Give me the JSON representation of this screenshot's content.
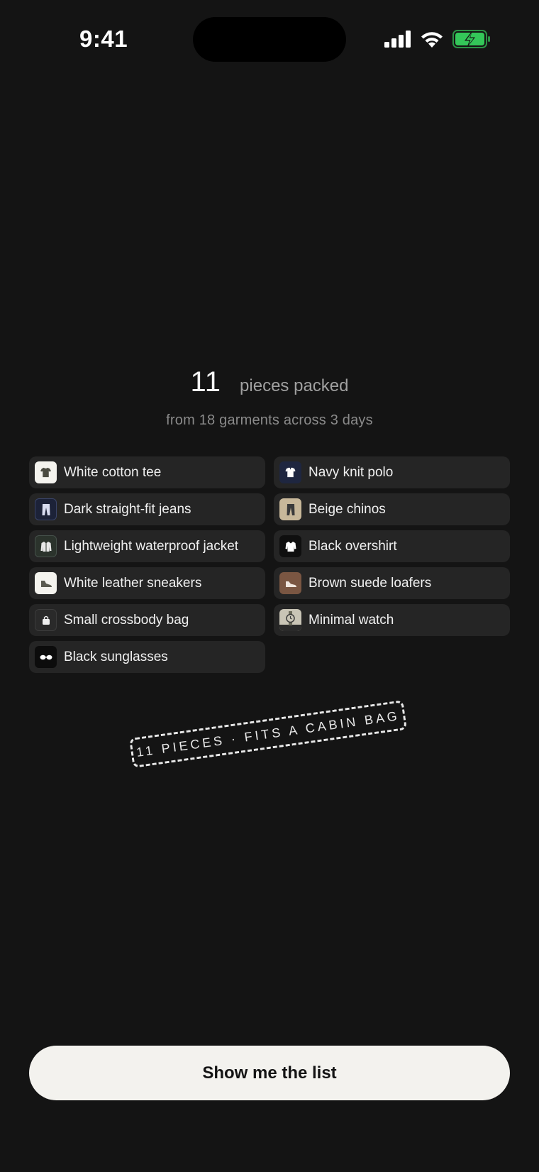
{
  "status_bar": {
    "time": "9:41"
  },
  "summary": {
    "count": "11",
    "count_label": "pieces packed",
    "subtitle": "from 18 garments across 3 days"
  },
  "items": [
    {
      "label": "White cotton tee",
      "icon": "tshirt-icon",
      "bg": "#f4f3ee",
      "fg": "#4a4a40"
    },
    {
      "label": "Navy knit polo",
      "icon": "polo-icon",
      "bg": "#1e2640",
      "fg": "#ffffff"
    },
    {
      "label": "Dark straight-fit jeans",
      "icon": "jeans-icon",
      "bg": "#1c2238",
      "fg": "#d8dcf0"
    },
    {
      "label": "Beige chinos",
      "icon": "chinos-icon",
      "bg": "#c8b89a",
      "fg": "#3a3a3a"
    },
    {
      "label": "Lightweight waterproof jacket",
      "icon": "jacket-icon",
      "bg": "#2b332c",
      "fg": "#e8e8e8"
    },
    {
      "label": "Black overshirt",
      "icon": "overshirt-icon",
      "bg": "#0f0f0f",
      "fg": "#ffffff"
    },
    {
      "label": "White leather sneakers",
      "icon": "sneaker-icon",
      "bg": "#f4f3ee",
      "fg": "#5a5a50"
    },
    {
      "label": "Brown suede loafers",
      "icon": "loafer-icon",
      "bg": "#7a5642",
      "fg": "#f0e6de"
    },
    {
      "label": "Small crossbody bag",
      "icon": "bag-icon",
      "bg": "#2a2a2a",
      "fg": "#f0f0f0"
    },
    {
      "label": "Minimal watch",
      "icon": "watch-icon",
      "bg": "#c9c5b6",
      "fg": "#2a2a2a"
    },
    {
      "label": "Black sunglasses",
      "icon": "sunglasses-icon",
      "bg": "#0c0c0c",
      "fg": "#ffffff"
    }
  ],
  "stamp": {
    "text": "11 PIECES · FITS A CABIN BAG"
  },
  "cta": {
    "label": "Show me the list"
  },
  "colors": {
    "background": "#141414",
    "chip": "#252525",
    "battery_fill": "#34c759",
    "button": "#f3f2ee"
  }
}
